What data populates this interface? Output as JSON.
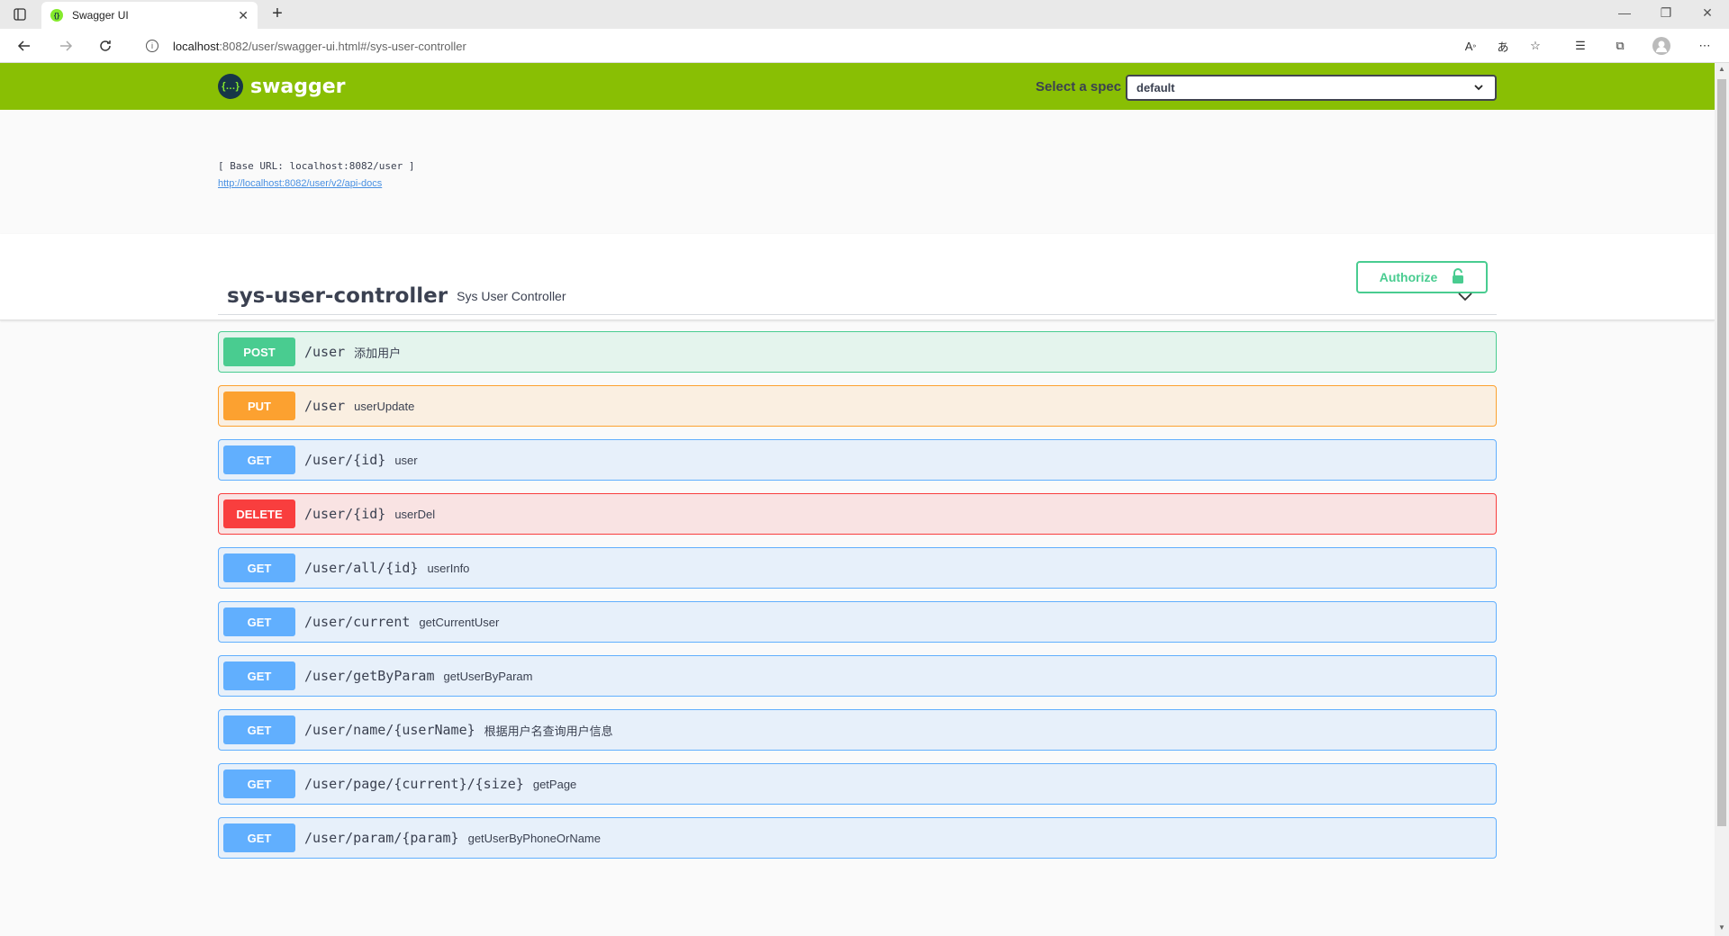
{
  "browser": {
    "tab_title": "Swagger UI",
    "url_host": "localhost",
    "url_rest": ":8082/user/swagger-ui.html#/sys-user-controller"
  },
  "topbar": {
    "logo_text": "swagger",
    "logo_glyph": "{…}",
    "spec_label": "Select a spec",
    "spec_value": "default"
  },
  "info": {
    "base_url": "[ Base URL: localhost:8082/user ]",
    "api_docs_link": "http://localhost:8082/user/v2/api-docs"
  },
  "scheme": {
    "authorize_label": "Authorize"
  },
  "tag": {
    "name": "sys-user-controller",
    "description": "Sys User Controller"
  },
  "operations": [
    {
      "method": "POST",
      "path": "/user",
      "summary": "添加用户"
    },
    {
      "method": "PUT",
      "path": "/user",
      "summary": "userUpdate"
    },
    {
      "method": "GET",
      "path": "/user/{id}",
      "summary": "user"
    },
    {
      "method": "DELETE",
      "path": "/user/{id}",
      "summary": "userDel"
    },
    {
      "method": "GET",
      "path": "/user/all/{id}",
      "summary": "userInfo"
    },
    {
      "method": "GET",
      "path": "/user/current",
      "summary": "getCurrentUser"
    },
    {
      "method": "GET",
      "path": "/user/getByParam",
      "summary": "getUserByParam"
    },
    {
      "method": "GET",
      "path": "/user/name/{userName}",
      "summary": "根据用户名查询用户信息"
    },
    {
      "method": "GET",
      "path": "/user/page/{current}/{size}",
      "summary": "getPage"
    },
    {
      "method": "GET",
      "path": "/user/param/{param}",
      "summary": "getUserByPhoneOrName"
    }
  ],
  "colors": {
    "topbar": "#89bf04",
    "post": "#49cc90",
    "put": "#fca130",
    "get": "#61affe",
    "delete": "#f93e3e"
  }
}
